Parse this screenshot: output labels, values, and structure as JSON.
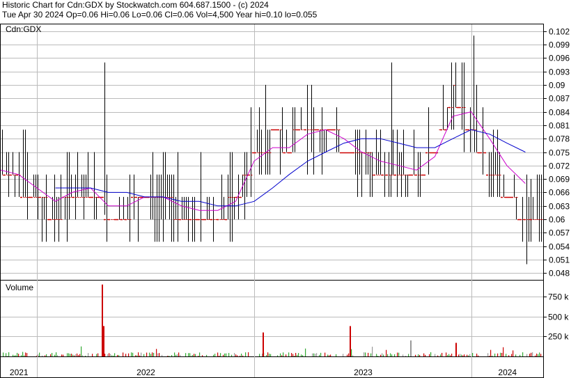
{
  "header": {
    "line1": "Historic Chart for Cdn:GDX by Stockwatch.com 604.687.1500 - (c) 2024",
    "line2": "Tue Apr 30 2024  Op=0.06  Hi=0.06  Lo=0.06  Cl=0.06  Vol=4,500  Year hi=0.10  lo=0.055"
  },
  "price_panel": {
    "label": "Cdn:GDX"
  },
  "volume_panel": {
    "label": "Volume"
  },
  "colors": {
    "price_bar": "#000000",
    "ma_short": "#cc00cc",
    "ma_long": "#0000cc",
    "tick_marker": "#cc0000",
    "vol_up": "#33aa33",
    "vol_down": "#cc0000",
    "vol_flat": "#999999",
    "grid": "#bbbbbb"
  },
  "chart_data": [
    {
      "type": "line",
      "title": "Cdn:GDX",
      "y_ticks": [
        "0.102",
        "0.099",
        "0.096",
        "0.093",
        "0.09",
        "0.087",
        "0.084",
        "0.081",
        "0.078",
        "0.075",
        "0.072",
        "0.069",
        "0.066",
        "0.063",
        "0.06",
        "0.057",
        "0.054",
        "0.051",
        "0.048"
      ],
      "x_ticks": [
        "2021",
        "2022",
        "2023",
        "2024"
      ],
      "ylim": [
        0.0465,
        0.1035
      ],
      "grid": true,
      "series": [
        {
          "kind": "close",
          "x": [
            "2021-11-01",
            "2021-12-01",
            "2022-01-01",
            "2022-02-01",
            "2022-03-01",
            "2022-04-01",
            "2022-05-01",
            "2022-06-01",
            "2022-07-01",
            "2022-08-01",
            "2022-09-01",
            "2022-10-01",
            "2022-11-01",
            "2022-12-01",
            "2023-01-01",
            "2023-02-01",
            "2023-03-01",
            "2023-04-01",
            "2023-05-01",
            "2023-06-01",
            "2023-07-01",
            "2023-08-01",
            "2023-09-01",
            "2023-10-01",
            "2023-11-01",
            "2023-12-01",
            "2024-01-01",
            "2024-02-01",
            "2024-03-01",
            "2024-04-01"
          ],
          "values": [
            0.072,
            0.068,
            0.064,
            0.061,
            0.065,
            0.066,
            0.061,
            0.062,
            0.064,
            0.064,
            0.061,
            0.062,
            0.061,
            0.064,
            0.074,
            0.078,
            0.077,
            0.08,
            0.079,
            0.077,
            0.073,
            0.072,
            0.071,
            0.07,
            0.075,
            0.088,
            0.08,
            0.07,
            0.066,
            0.06
          ]
        },
        {
          "kind": "moving-average-short",
          "x": [
            "2021-11-01",
            "2021-12-01",
            "2022-01-01",
            "2022-02-01",
            "2022-03-01",
            "2022-04-01",
            "2022-05-01",
            "2022-06-01",
            "2022-07-01",
            "2022-08-01",
            "2022-09-01",
            "2022-10-01",
            "2022-11-01",
            "2022-12-01",
            "2023-01-01",
            "2023-02-01",
            "2023-03-01",
            "2023-04-01",
            "2023-05-01",
            "2023-06-01",
            "2023-07-01",
            "2023-08-01",
            "2023-09-01",
            "2023-10-01",
            "2023-11-01",
            "2023-12-01",
            "2024-01-01",
            "2024-02-01",
            "2024-03-01",
            "2024-04-01"
          ],
          "values": [
            0.071,
            0.07,
            0.067,
            0.064,
            0.066,
            0.067,
            0.063,
            0.063,
            0.065,
            0.065,
            0.063,
            0.062,
            0.062,
            0.064,
            0.073,
            0.076,
            0.076,
            0.079,
            0.08,
            0.078,
            0.075,
            0.073,
            0.072,
            0.071,
            0.074,
            0.083,
            0.084,
            0.078,
            0.072,
            0.068
          ]
        },
        {
          "kind": "moving-average-long",
          "x": [
            "2021-11-01",
            "2021-12-01",
            "2022-01-01",
            "2022-02-01",
            "2022-03-01",
            "2022-04-01",
            "2022-05-01",
            "2022-06-01",
            "2022-07-01",
            "2022-08-01",
            "2022-09-01",
            "2022-10-01",
            "2022-11-01",
            "2022-12-01",
            "2023-01-01",
            "2023-02-01",
            "2023-03-01",
            "2023-04-01",
            "2023-05-01",
            "2023-06-01",
            "2023-07-01",
            "2023-08-01",
            "2023-09-01",
            "2023-10-01",
            "2023-11-01",
            "2023-12-01",
            "2024-01-01",
            "2024-02-01",
            "2024-03-01",
            "2024-04-01"
          ],
          "values": [
            null,
            null,
            null,
            0.067,
            0.067,
            0.067,
            0.066,
            0.066,
            0.065,
            0.065,
            0.064,
            0.064,
            0.063,
            0.063,
            0.064,
            0.067,
            0.07,
            0.073,
            0.075,
            0.077,
            0.078,
            0.078,
            0.077,
            0.076,
            0.076,
            0.078,
            0.08,
            0.079,
            0.077,
            0.075
          ]
        }
      ]
    },
    {
      "type": "bar",
      "title": "Volume",
      "y_ticks": [
        "750 k",
        "500 k",
        "250 k"
      ],
      "x_ticks": [
        "2021",
        "2022",
        "2023",
        "2024"
      ],
      "ylim": [
        0,
        950000
      ],
      "grid": true,
      "series": [
        {
          "kind": "volume-notable",
          "x": [
            "2022-04-20",
            "2022-04-22",
            "2023-01-15",
            "2023-06-10",
            "2023-09-20",
            "2023-12-05"
          ],
          "values": [
            900000,
            380000,
            300000,
            380000,
            200000,
            170000
          ]
        }
      ]
    }
  ]
}
